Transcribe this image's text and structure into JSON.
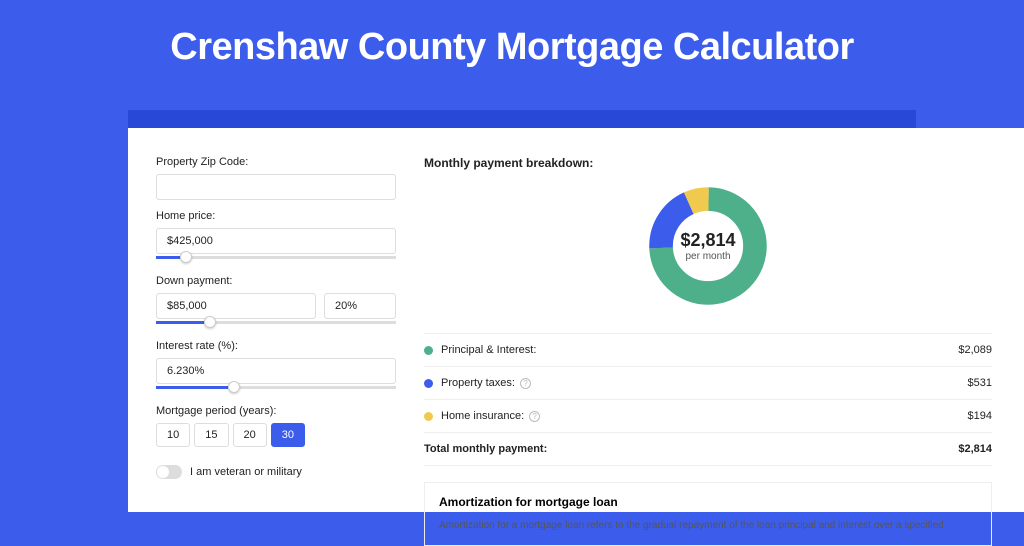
{
  "title": "Crenshaw County Mortgage Calculator",
  "form": {
    "zip_label": "Property Zip Code:",
    "zip_value": "",
    "home_price_label": "Home price:",
    "home_price_value": "$425,000",
    "down_payment_label": "Down payment:",
    "down_payment_value": "$85,000",
    "down_payment_pct": "20%",
    "interest_label": "Interest rate (%):",
    "interest_value": "6.230%",
    "period_label": "Mortgage period (years):",
    "periods": [
      "10",
      "15",
      "20",
      "30"
    ],
    "period_active": "30",
    "vet_label": "I am veteran or military"
  },
  "breakdown": {
    "title": "Monthly payment breakdown:",
    "total_amount": "$2,814",
    "total_sub": "per month",
    "items": [
      {
        "label": "Principal & Interest:",
        "value": "$2,089",
        "color": "#4db08a"
      },
      {
        "label": "Property taxes:",
        "value": "$531",
        "color": "#3c5cec",
        "info": true
      },
      {
        "label": "Home insurance:",
        "value": "$194",
        "color": "#f0c94f",
        "info": true
      }
    ],
    "total_label": "Total monthly payment:",
    "total_value": "$2,814"
  },
  "amort": {
    "title": "Amortization for mortgage loan",
    "text": "Amortization for a mortgage loan refers to the gradual repayment of the loan principal and interest over a specified"
  },
  "chart_data": {
    "type": "pie",
    "title": "Monthly payment breakdown",
    "series": [
      {
        "name": "Principal & Interest",
        "value": 2089,
        "color": "#4db08a"
      },
      {
        "name": "Property taxes",
        "value": 531,
        "color": "#3c5cec"
      },
      {
        "name": "Home insurance",
        "value": 194,
        "color": "#f0c94f"
      }
    ],
    "total": 2814
  }
}
